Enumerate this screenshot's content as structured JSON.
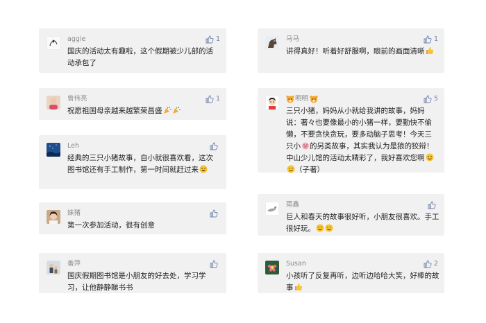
{
  "colors": {
    "card_bg": "#f1f1f1",
    "name": "#8a8a8a",
    "like": "#6e82a8",
    "text": "#222222"
  },
  "comments": [
    {
      "id": "c1",
      "name": "aggie",
      "avatar": "white-sketch-avatar",
      "likes": "1",
      "text": "国庆的活动太有趣啦，这个假期被少儿部的活动承包了",
      "emojis": []
    },
    {
      "id": "c2",
      "name": "曾伟亮",
      "avatar": "child-photo-avatar",
      "likes": "1",
      "text": "祝愿祖国母亲越来越繁荣昌盛",
      "emojis": [
        "party-popper-icon",
        "party-popper-icon"
      ]
    },
    {
      "id": "c3",
      "name": "Leh",
      "avatar": "blue-night-avatar",
      "likes": "",
      "text": "经典的三只小猪故事，自小就很喜欢看，这次图书馆还有手工制作，第一时间就赶过来",
      "emojis": [
        "grin-face-icon"
      ]
    },
    {
      "id": "c4",
      "name": "妹猪",
      "avatar": "girl-photo-avatar",
      "likes": "",
      "text": "第一次参加活动，很有创意",
      "emojis": []
    },
    {
      "id": "c5",
      "name": "善萍",
      "avatar": "family-photo-avatar",
      "likes": "",
      "text": "国庆假期图书馆是小朋友的好去处，学习学习，让他静静睇书书",
      "emojis": []
    },
    {
      "id": "c6",
      "name": "马马",
      "avatar": "horse-avatar",
      "likes": "1",
      "text": "讲得真好！听着好舒服啊，眼前的画面清晰",
      "emojis": [
        "thumbs-up-emoji-icon"
      ]
    },
    {
      "id": "c7",
      "name": "明明",
      "name_decor": "tiger-face-icon",
      "avatar": "cartoon-kid-avatar",
      "likes": "5",
      "text_a": "三只小猪，妈妈从小就给我讲的故事，妈妈说：著々也要像最小的小猪一样，要勤快不偷懒，不要贪快贪玩，要多动脑子思考！今天三只小",
      "text_b": "的另类故事，其实我认为是狼的狡辩！中山少儿馆的活动太精彩了，我好喜欢您啊",
      "text_c": "（子著）",
      "emojis": [
        "pig-face-icon",
        "smile-face-icon",
        "smile-face-icon"
      ]
    },
    {
      "id": "c8",
      "name": "雨鑫",
      "avatar": "bird-sketch-avatar",
      "likes": "",
      "text": "巨人和春天的故事很好听，小朋友很喜欢。手工很好玩。",
      "emojis": [
        "smile-face-icon",
        "smile-face-icon"
      ]
    },
    {
      "id": "c9",
      "name": "Susan",
      "avatar": "flower-avatar",
      "likes": "2",
      "text": "小孩听了反复再听，边听边哈哈大笑，好棒的故事",
      "emojis": [
        "thumbs-up-emoji-icon"
      ]
    }
  ]
}
